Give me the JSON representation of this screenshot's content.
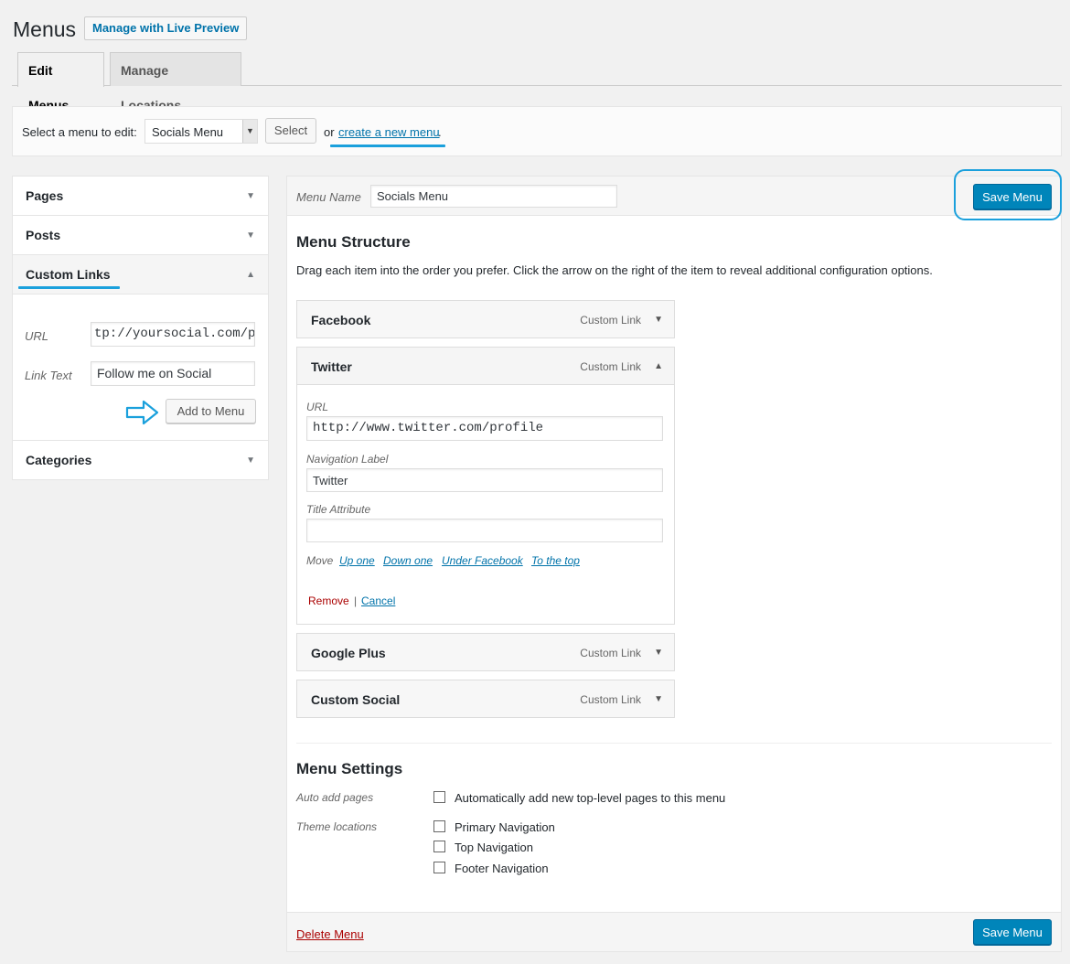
{
  "header": {
    "title": "Menus",
    "live_preview": "Manage with Live Preview"
  },
  "tabs": [
    {
      "label": "Edit Menus"
    },
    {
      "label": "Manage Locations"
    }
  ],
  "select_bar": {
    "label": "Select a menu to edit:",
    "selected": "Socials Menu",
    "select_button": "Select",
    "or": "or",
    "create_link": "create a new menu",
    "period": "."
  },
  "left": {
    "sections": [
      {
        "title": "Pages"
      },
      {
        "title": "Posts"
      },
      {
        "title": "Custom Links"
      },
      {
        "title": "Categories"
      }
    ],
    "custom_links": {
      "url_label": "URL",
      "url_value": "tp://yoursocial.com/pr",
      "text_label": "Link Text",
      "text_value": "Follow me on Social",
      "add_button": "Add to Menu"
    }
  },
  "editor": {
    "name_label": "Menu Name",
    "name_value": "Socials Menu",
    "save_label": "Save Menu",
    "structure_title": "Menu Structure",
    "structure_desc": "Drag each item into the order you prefer. Click the arrow on the right of the item to reveal additional configuration options.",
    "items": [
      {
        "title": "Facebook",
        "type": "Custom Link"
      },
      {
        "title": "Twitter",
        "type": "Custom Link"
      },
      {
        "title": "Google Plus",
        "type": "Custom Link"
      },
      {
        "title": "Custom Social",
        "type": "Custom Link"
      }
    ],
    "twitter_settings": {
      "url_label": "URL",
      "url_value": "http://www.twitter.com/profile",
      "nav_label": "Navigation Label",
      "nav_value": "Twitter",
      "title_attr_label": "Title Attribute",
      "title_attr_value": "",
      "move_label": "Move",
      "move_links": [
        "Up one",
        "Down one",
        "Under Facebook",
        "To the top"
      ],
      "remove": "Remove",
      "separator": "|",
      "cancel": "Cancel"
    },
    "settings": {
      "title": "Menu Settings",
      "auto_add_label": "Auto add pages",
      "auto_add_option": "Automatically add new top-level pages to this menu",
      "theme_label": "Theme locations",
      "locations": [
        "Primary Navigation",
        "Top Navigation",
        "Footer Navigation"
      ]
    },
    "delete_menu": "Delete Menu"
  },
  "icons": {
    "dropdown": "triangle-down",
    "collapse": "triangle-up",
    "pointer": "arrow-right-outline"
  },
  "colors": {
    "primary": "#0085ba",
    "link": "#0073aa",
    "danger": "#aa0000",
    "highlight": "#1aa0dc"
  }
}
